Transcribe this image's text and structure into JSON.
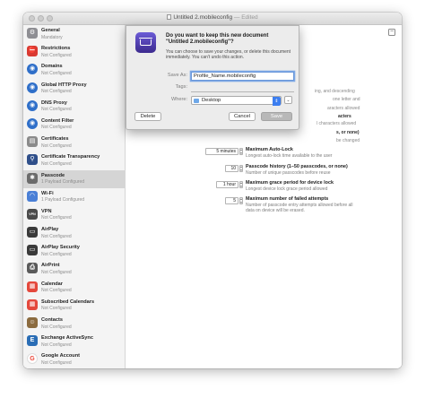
{
  "window": {
    "title": "Untitled 2.mobileconfig",
    "title_suffix": "— Edited"
  },
  "sidebar": {
    "items": [
      {
        "name": "General",
        "sub": "Mandatory",
        "icon": "gear-icon",
        "color": "#8e8e93",
        "glyph": "⚙"
      },
      {
        "name": "Restrictions",
        "sub": "Not Configured",
        "icon": "restrictions-icon",
        "color": "#d93a31",
        "glyph": "⛔"
      },
      {
        "name": "Domains",
        "sub": "Not Configured",
        "icon": "globe-icon",
        "color": "#2f6fc9",
        "glyph": "◉"
      },
      {
        "name": "Global HTTP Proxy",
        "sub": "Not Configured",
        "icon": "globe-icon",
        "color": "#2f6fc9",
        "glyph": "◉"
      },
      {
        "name": "DNS Proxy",
        "sub": "Not Configured",
        "icon": "globe-icon",
        "color": "#2f6fc9",
        "glyph": "◉"
      },
      {
        "name": "Content Filter",
        "sub": "Not Configured",
        "icon": "globe-icon",
        "color": "#2f6fc9",
        "glyph": "◉"
      },
      {
        "name": "Certificates",
        "sub": "Not Configured",
        "icon": "certificate-icon",
        "color": "#8a8a8a",
        "glyph": "▤"
      },
      {
        "name": "Certificate Transparency",
        "sub": "Not Configured",
        "icon": "search-icon",
        "color": "#2f4f8a",
        "glyph": "⚲"
      },
      {
        "name": "Passcode",
        "sub": "1 Payload Configured",
        "icon": "lock-icon",
        "color": "#6b6b6b",
        "glyph": "✱"
      },
      {
        "name": "Wi-Fi",
        "sub": "1 Payload Configured",
        "icon": "wifi-icon",
        "color": "#4a7fd6",
        "glyph": "◠"
      },
      {
        "name": "VPN",
        "sub": "Not Configured",
        "icon": "vpn-icon",
        "color": "#4a4a4a",
        "glyph": "VPN"
      },
      {
        "name": "AirPlay",
        "sub": "Not Configured",
        "icon": "airplay-icon",
        "color": "#3a3a3a",
        "glyph": "▭"
      },
      {
        "name": "AirPlay Security",
        "sub": "Not Configured",
        "icon": "airplay-security-icon",
        "color": "#3a3a3a",
        "glyph": "▭"
      },
      {
        "name": "AirPrint",
        "sub": "Not Configured",
        "icon": "printer-icon",
        "color": "#5a5a5a",
        "glyph": "⎙"
      },
      {
        "name": "Calendar",
        "sub": "Not Configured",
        "icon": "calendar-icon",
        "color": "#e4483c",
        "glyph": "▦"
      },
      {
        "name": "Subscribed Calendars",
        "sub": "Not Configured",
        "icon": "calendar-icon",
        "color": "#e4483c",
        "glyph": "▦"
      },
      {
        "name": "Contacts",
        "sub": "Not Configured",
        "icon": "contacts-icon",
        "color": "#8b6b3f",
        "glyph": "☺"
      },
      {
        "name": "Exchange ActiveSync",
        "sub": "Not Configured",
        "icon": "exchange-icon",
        "color": "#2a6db5",
        "glyph": "E"
      },
      {
        "name": "Google Account",
        "sub": "Not Configured",
        "icon": "google-icon",
        "color": "#ea4335",
        "glyph": "G"
      }
    ]
  },
  "content": {
    "partials": [
      "ing, and descending",
      "one letter and",
      "aracters allowed",
      "acters",
      "l characters allowed",
      "s, or none)",
      "be changed"
    ],
    "settings": [
      {
        "value": "5 minutes",
        "title": "Maximum Auto-Lock",
        "desc": [
          "Longest auto-lock time available to the user"
        ]
      },
      {
        "value": "10",
        "title": "Passcode history (1–50 passcodes, or none)",
        "desc": [
          "Number of unique passcodes before reuse"
        ]
      },
      {
        "value": "1 hour",
        "title": "Maximum grace period for device lock",
        "desc": [
          "Longest device lock grace period allowed"
        ]
      },
      {
        "value": "5",
        "title": "Maximum number of failed attempts",
        "desc": [
          "Number of passcode entry attempts allowed before all",
          "data on device will be erased."
        ]
      }
    ]
  },
  "dialog": {
    "title": "Do you want to keep this new document \"Untitled 2.mobileconfig\"?",
    "message": "You can choose to save your changes, or delete this document immediately. You can't undo this action.",
    "save_as_label": "Save As:",
    "save_as_value": "Profile_Name.mobileconfig",
    "tags_label": "Tags:",
    "where_label": "Where:",
    "where_value": "Desktop",
    "delete_label": "Delete",
    "cancel_label": "Cancel",
    "save_label": "Save"
  }
}
